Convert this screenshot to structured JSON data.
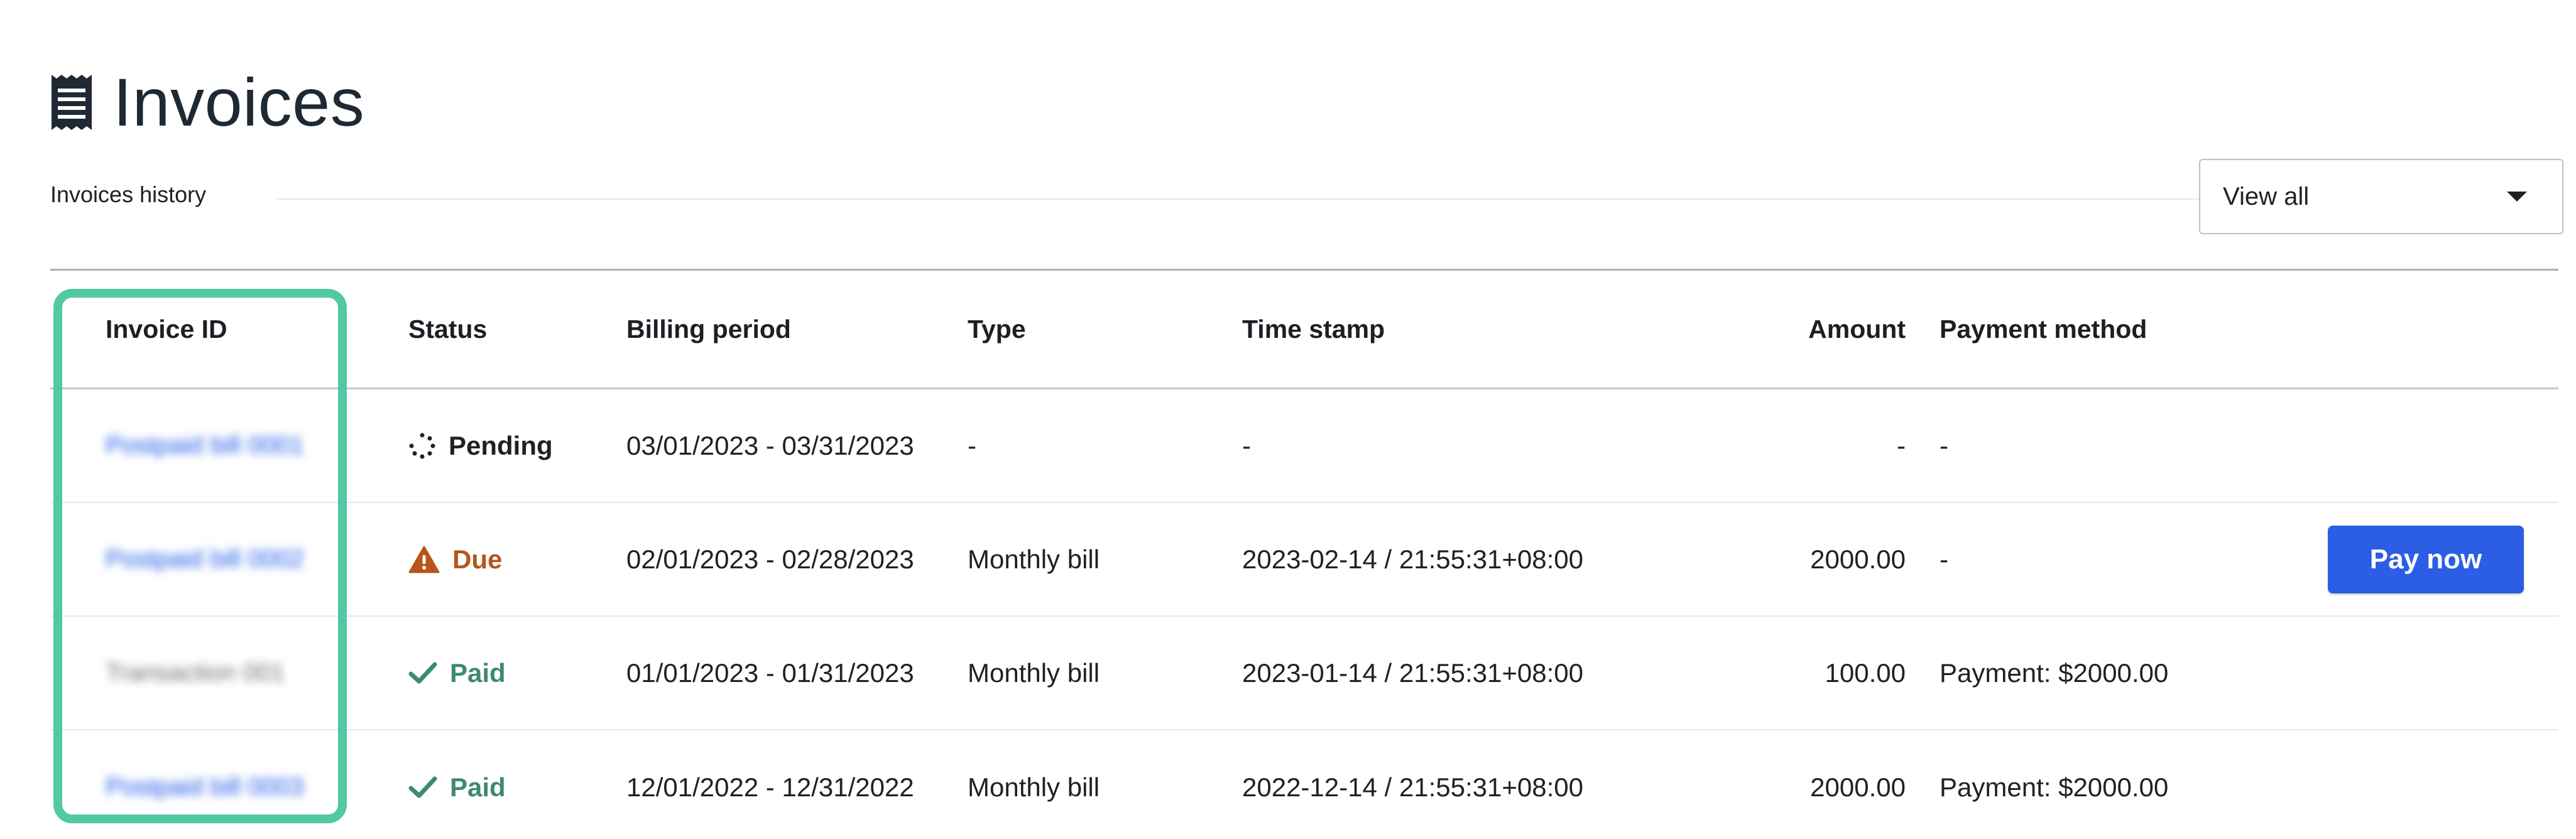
{
  "page": {
    "title": "Invoices",
    "title_icon": "receipt-icon"
  },
  "subheader": {
    "label": "Invoices history",
    "filter": {
      "selected": "View all",
      "icon": "caret-down-icon"
    }
  },
  "table": {
    "columns": {
      "invoice_id": "Invoice ID",
      "status": "Status",
      "billing_period": "Billing period",
      "type": "Type",
      "time_stamp": "Time stamp",
      "amount": "Amount",
      "payment_method": "Payment method"
    },
    "rows": [
      {
        "invoice_id": "Postpaid bill 0001",
        "status": "Pending",
        "status_icon": "spinner-icon",
        "billing_period": "03/01/2023 - 03/31/2023",
        "type": "-",
        "time_stamp": "-",
        "amount": "-",
        "payment_method": "-"
      },
      {
        "invoice_id": "Postpaid bill 0002",
        "status": "Due",
        "status_icon": "warning-icon",
        "billing_period": "02/01/2023 - 02/28/2023",
        "type": "Monthly bill",
        "time_stamp": "2023-02-14 / 21:55:31+08:00",
        "amount": "2000.00",
        "payment_method": "-",
        "action": "Pay now"
      },
      {
        "invoice_id": "Transaction 001",
        "status": "Paid",
        "status_icon": "check-icon",
        "billing_period": "01/01/2023 - 01/31/2023",
        "type": "Monthly bill",
        "time_stamp": "2023-01-14 / 21:55:31+08:00",
        "amount": "100.00",
        "payment_method": "Payment: $2000.00"
      },
      {
        "invoice_id": "Postpaid bill 0003",
        "status": "Paid",
        "status_icon": "check-icon",
        "billing_period": "12/01/2022 - 12/31/2022",
        "type": "Monthly bill",
        "time_stamp": "2022-12-14 / 21:55:31+08:00",
        "amount": "2000.00",
        "payment_method": "Payment: $2000.00"
      }
    ]
  },
  "colors": {
    "accent": "#2b5ee5",
    "highlight": "#52c8a5",
    "due": "#b5561c",
    "paid": "#3d8a6e"
  }
}
